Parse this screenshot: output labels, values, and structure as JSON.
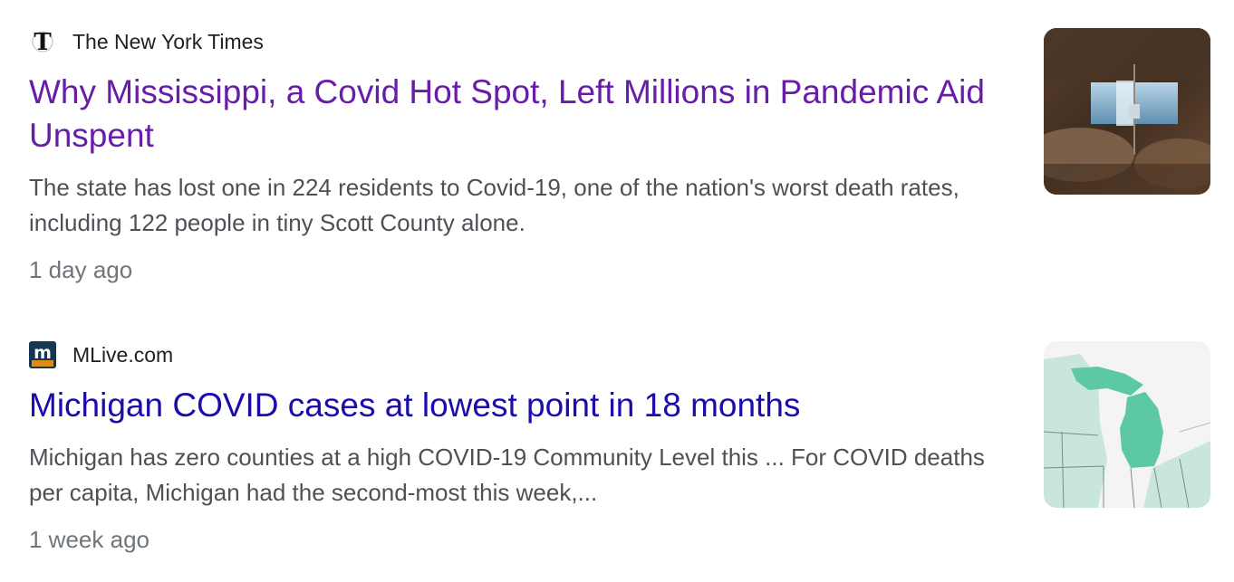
{
  "results": [
    {
      "source": "The New York Times",
      "source_icon": "nyt-logo-icon",
      "headline": "Why Mississippi, a Covid Hot Spot, Left Millions in Pandemic Aid Unspent",
      "headline_color": "#681da8",
      "snippet": "The state has lost one in 224 residents to Covid-19, one of the nation's worst death rates, including 122 people in tiny Scott County alone.",
      "age": "1 day ago",
      "thumbnail": "hospital-ward-image"
    },
    {
      "source": "MLive.com",
      "source_icon": "mlive-logo-icon",
      "headline": "Michigan COVID cases at lowest point in 18 months",
      "headline_color": "#1a0dab",
      "snippet": "Michigan has zero counties at a high COVID-19 Community Level this ... For COVID deaths per capita, Michigan had the second-most this week,...",
      "age": "1 week ago",
      "thumbnail": "michigan-map-image"
    }
  ]
}
